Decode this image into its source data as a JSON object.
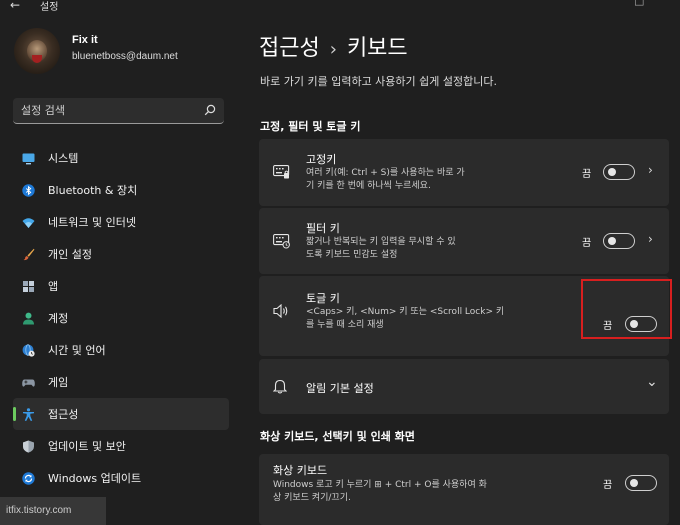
{
  "window": {
    "title": "설정"
  },
  "profile": {
    "name": "Fix it",
    "email": "bluenetboss@daum.net"
  },
  "search": {
    "placeholder": "설정 검색"
  },
  "sidebar": {
    "items": [
      {
        "label": "시스템",
        "icon": "system-icon"
      },
      {
        "label": "Bluetooth & 장치",
        "icon": "bluetooth-icon"
      },
      {
        "label": "네트워크 및 인터넷",
        "icon": "wifi-icon"
      },
      {
        "label": "개인 설정",
        "icon": "brush-icon"
      },
      {
        "label": "앱",
        "icon": "apps-icon"
      },
      {
        "label": "계정",
        "icon": "account-icon"
      },
      {
        "label": "시간 및 언어",
        "icon": "globe-clock-icon"
      },
      {
        "label": "게임",
        "icon": "gamepad-icon"
      },
      {
        "label": "접근성",
        "icon": "accessibility-icon",
        "active": true
      },
      {
        "label": "업데이트 및 보안",
        "icon": "shield-icon"
      },
      {
        "label": "Windows 업데이트",
        "icon": "refresh-icon"
      }
    ]
  },
  "main": {
    "breadcrumb": {
      "parent": "접근성",
      "separator": "›",
      "current": "키보드"
    },
    "description": "바로 가기 키를 입력하고 사용하기 쉽게 설정합니다.",
    "sections": [
      {
        "title": "고정, 필터 및 토글 키",
        "cards": [
          {
            "title": "고정키",
            "desc1": "여러 키(예: Ctrl + S)를 사용하는 바로 가",
            "desc2": "기 키를 한 번에 하나씩 누르세요.",
            "state": "끔",
            "chevron": "›"
          },
          {
            "title": "필터 키",
            "desc1": "짧거나 반복되는 키 입력을 무시할 수 있",
            "desc2": "도록 키보드 민감도 설정",
            "state": "끔",
            "chevron": "›"
          },
          {
            "title": "토글 키",
            "desc1": "<Caps> 키, <Num> 키 또는 <Scroll Lock> 키",
            "desc2": "를 누를 때 소리 재생",
            "state": "끔"
          },
          {
            "title": "알림 기본 설정",
            "chevron": "⌄"
          }
        ]
      },
      {
        "title": "화상 키보드, 선택키 및 인쇄 화면",
        "cards": [
          {
            "title": "화상 키보드",
            "desc1": "Windows 로고 키 누르기 ⊞ + Ctrl + O를 사용하여 화",
            "desc2": "상 키보드 켜기/끄기.",
            "state": "끔"
          }
        ]
      }
    ]
  },
  "watermark": "itfix.tistory.com",
  "colors": {
    "accent": "#6ccb5f",
    "highlight": "#d81f1f",
    "background": "#1f1f1f",
    "card": "#2b2b2b"
  }
}
